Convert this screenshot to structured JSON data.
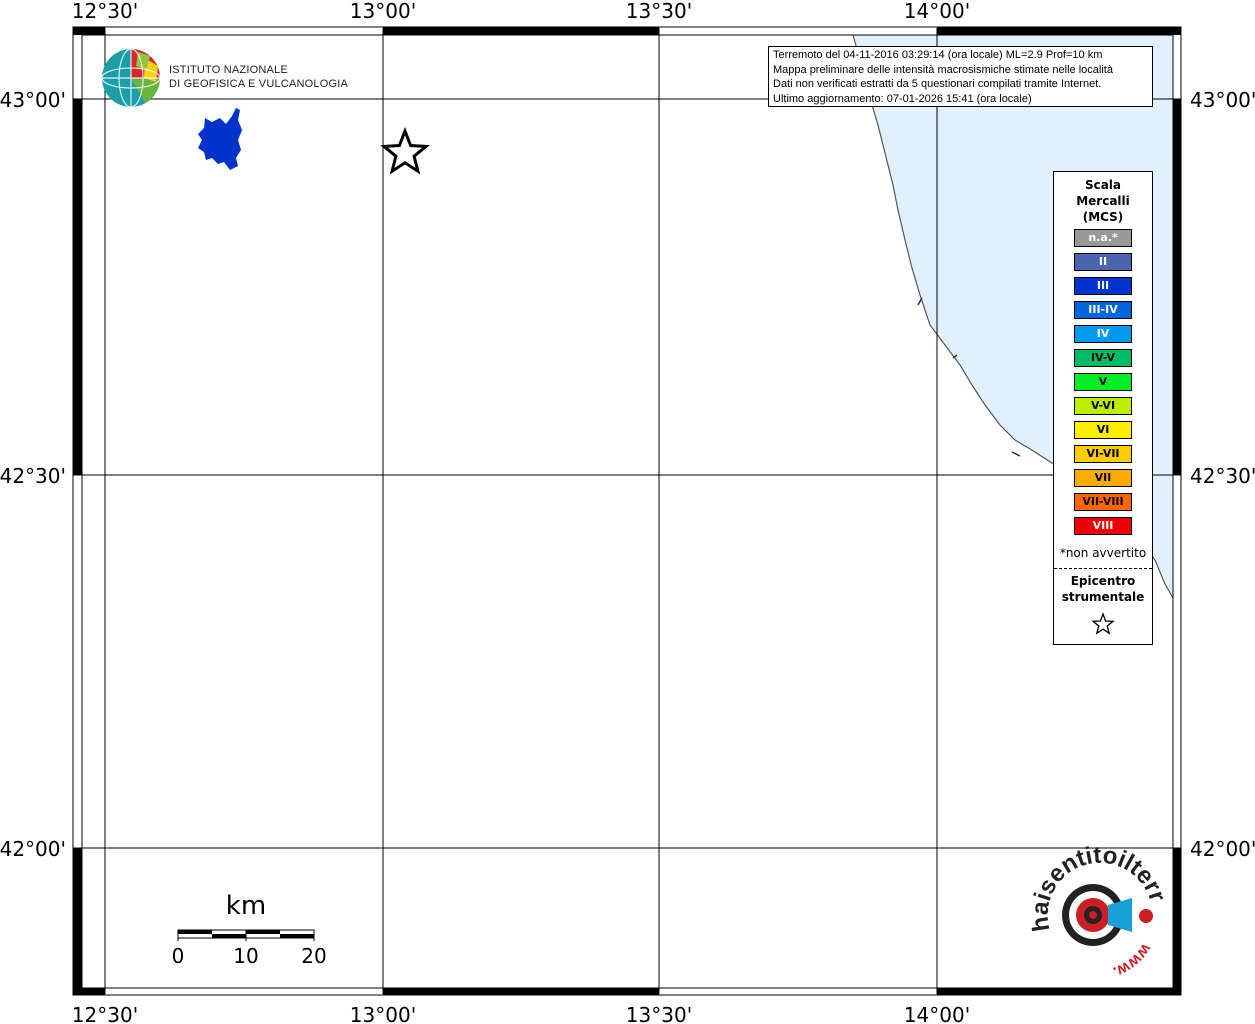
{
  "map": {
    "axes": {
      "lon_labels": [
        "12°30'",
        "13°00'",
        "13°30'",
        "14°00'"
      ],
      "lat_labels": [
        "43°00'",
        "42°30'",
        "42°00'"
      ]
    },
    "colors": {
      "sea": "#e0f0ff",
      "lake": "#0033cc",
      "frame": "#000000",
      "grid": "#000000"
    },
    "lake_icon": "lake-trasimeno-shape",
    "epicenter_icon": "star-outline-icon"
  },
  "info": {
    "line1": "Terremoto del 04-11-2016 03:29:14 (ora locale) ML=2.9 Prof=10 km",
    "line2": "Mappa preliminare delle intensità macrosismiche stimate nelle località",
    "line3": "Dati non verificati estratti da 5 questionari compilati tramite Internet.",
    "line4": "Ultimo aggiornamento: 07-01-2026 15:41 (ora locale)"
  },
  "logo": {
    "ingv_line1": "ISTITUTO NAZIONALE",
    "ingv_line2": "DI GEOFISICA E VULCANOLOGIA",
    "hsit_text1": "haisentitoilterremoto.it",
    "hsit_text2": "www.",
    "hsit_icon": "hsit-logo-icon"
  },
  "legend": {
    "title": "Scala\nMercalli\n(MCS)",
    "items": [
      {
        "label": "n.a.*",
        "color": "#999999",
        "text": "#ffffff"
      },
      {
        "label": "II",
        "color": "#4a64b0",
        "text": "#ffffff"
      },
      {
        "label": "III",
        "color": "#0033cc",
        "text": "#ffffff"
      },
      {
        "label": "III-IV",
        "color": "#0066dd",
        "text": "#ffffff"
      },
      {
        "label": "IV",
        "color": "#0099ee",
        "text": "#ffffff"
      },
      {
        "label": "IV-V",
        "color": "#00bb66",
        "text": "#000000"
      },
      {
        "label": "V",
        "color": "#00ee22",
        "text": "#000000"
      },
      {
        "label": "V-VI",
        "color": "#bbee00",
        "text": "#000000"
      },
      {
        "label": "VI",
        "color": "#ffee00",
        "text": "#000000"
      },
      {
        "label": "VI-VII",
        "color": "#ffcc00",
        "text": "#000000"
      },
      {
        "label": "VII",
        "color": "#ffaa00",
        "text": "#000000"
      },
      {
        "label": "VII-VIII",
        "color": "#ff6600",
        "text": "#000000"
      },
      {
        "label": "VIII",
        "color": "#ee0000",
        "text": "#ffffff"
      }
    ],
    "note": "*non avvertito",
    "epicenter_label": "Epicentro\nstrumentale"
  },
  "scalebar": {
    "unit": "km",
    "ticks": [
      "0",
      "10",
      "20"
    ]
  }
}
